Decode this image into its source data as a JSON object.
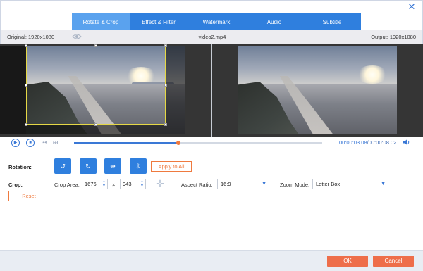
{
  "window": {
    "close_glyph": "✕"
  },
  "tabs": [
    {
      "label": "Rotate & Crop",
      "active": true
    },
    {
      "label": "Effect & Filter",
      "active": false
    },
    {
      "label": "Watermark",
      "active": false
    },
    {
      "label": "Audio",
      "active": false
    },
    {
      "label": "Subtitle",
      "active": false
    }
  ],
  "infobar": {
    "original": "Original: 1920x1080",
    "filename": "video2.mp4",
    "output": "Output: 1920x1080"
  },
  "transport": {
    "progress_fraction": 0.42,
    "current_time": "00:00:03.08",
    "separator": "/",
    "total_time": "00:00:08.02"
  },
  "rotation": {
    "label": "Rotation:",
    "buttons": [
      {
        "icon": "rotate-left-icon",
        "glyph": "↺"
      },
      {
        "icon": "rotate-right-icon",
        "glyph": "↻"
      },
      {
        "icon": "flip-horizontal-icon",
        "glyph": "⇹"
      },
      {
        "icon": "flip-vertical-icon",
        "glyph": "⇳"
      }
    ],
    "apply_label": "Apply to All"
  },
  "crop": {
    "label": "Crop:",
    "area_label": "Crop Area:",
    "width": "1676",
    "times": "×",
    "height": "943",
    "aspect_label": "Aspect Ratio:",
    "aspect_value": "16:9",
    "zoom_label": "Zoom Mode:",
    "zoom_value": "Letter Box",
    "reset_label": "Reset"
  },
  "footer": {
    "ok_label": "OK",
    "cancel_label": "Cancel"
  },
  "colors": {
    "accent": "#2f7fde",
    "orange": "#ef7a3f",
    "crop_border": "#e5d846"
  }
}
